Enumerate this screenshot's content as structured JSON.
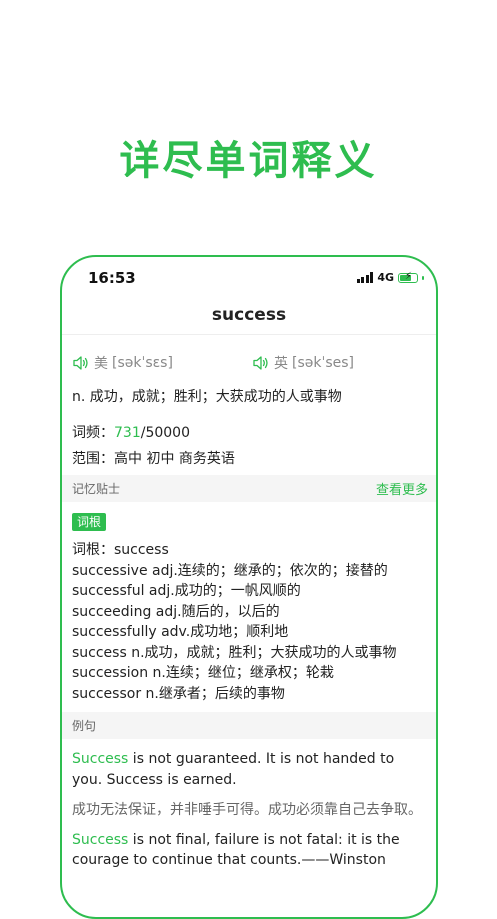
{
  "headline": "详尽单词释义",
  "status_bar": {
    "time": "16:53",
    "network": "4G"
  },
  "word": "success",
  "phonetics": {
    "us_label": "美",
    "us_ipa": "[səkˈsɛs]",
    "uk_label": "英",
    "uk_ipa": "[səkˈses]"
  },
  "definition": "n. 成功，成就；胜利；大获成功的人或事物",
  "frequency": {
    "label": "词频：",
    "rank": "731",
    "total": "/50000"
  },
  "scope": {
    "label": "范围：",
    "value": "高中 初中 商务英语"
  },
  "memory_tips": {
    "section_title": "记忆贴士",
    "more_label": "查看更多",
    "tag": "词根",
    "lines": [
      "词根：success",
      "successive adj.连续的；继承的；依次的；接替的",
      "successful adj.成功的；一帆风顺的",
      "succeeding adj.随后的，以后的",
      "successfully adv.成功地；顺利地",
      "success n.成功，成就；胜利；大获成功的人或事物",
      "succession n.连续；继位；继承权；轮栽",
      "successor n.继承者；后续的事物"
    ]
  },
  "examples": {
    "section_title": "例句",
    "items": [
      {
        "highlight": "Success",
        "en_rest": " is not guaranteed. It is not handed to you. Success is earned.",
        "zh": "成功无法保证，并非唾手可得。成功必须靠自己去争取。"
      },
      {
        "highlight": "Success",
        "en_rest": " is not final, failure is not fatal: it is the courage to continue that counts.——Winston",
        "zh": ""
      }
    ]
  },
  "colors": {
    "accent": "#2ebd4f",
    "section_bg": "#f5f5f5"
  },
  "icons": {
    "speaker": "speaker-icon",
    "signal": "signal-icon",
    "battery": "battery-charging-icon"
  }
}
